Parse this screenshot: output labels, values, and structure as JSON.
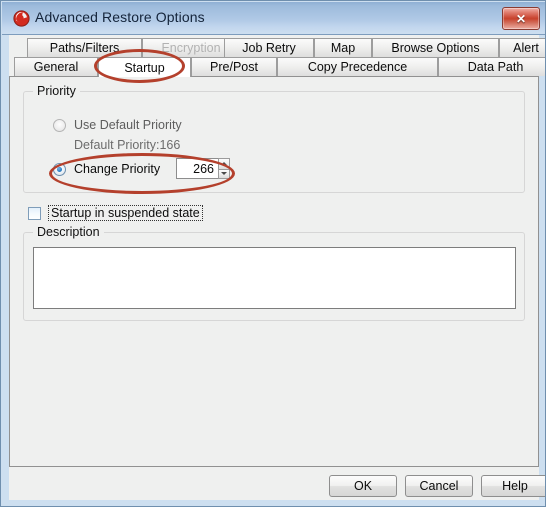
{
  "window": {
    "title": "Advanced Restore Options",
    "icon": "app-logo-icon",
    "close_label": "✕"
  },
  "tabs": {
    "row1": [
      {
        "label": "Paths/Filters",
        "state": "normal"
      },
      {
        "label": "Encryption",
        "state": "disabled"
      },
      {
        "label": "Job Retry",
        "state": "normal"
      },
      {
        "label": "Map",
        "state": "normal"
      },
      {
        "label": "Browse Options",
        "state": "normal"
      },
      {
        "label": "Alert",
        "state": "normal"
      }
    ],
    "row2": [
      {
        "label": "General",
        "state": "normal"
      },
      {
        "label": "Startup",
        "state": "selected"
      },
      {
        "label": "Pre/Post",
        "state": "normal"
      },
      {
        "label": "Copy Precedence",
        "state": "normal"
      },
      {
        "label": "Data Path",
        "state": "normal"
      }
    ]
  },
  "priority": {
    "group_title": "Priority",
    "use_default_label": "Use Default Priority",
    "use_default_selected": false,
    "default_priority_text": "Default Priority:166",
    "change_priority_label": "Change Priority",
    "change_priority_selected": true,
    "priority_value": "266"
  },
  "suspend": {
    "label": "Startup in suspended state",
    "checked": false
  },
  "description": {
    "group_title": "Description",
    "value": "",
    "placeholder": ""
  },
  "buttons": {
    "ok": "OK",
    "cancel": "Cancel",
    "help": "Help"
  },
  "annotations": {
    "accent_color": "#b4402c",
    "highlighted": [
      "Startup tab",
      "Change Priority row"
    ]
  },
  "colors": {
    "titlebar_blue": "#b0c9e6",
    "frame_blue": "#cddff0",
    "panel_gray": "#eff0ef",
    "close_red": "#c8412c",
    "annotation_red": "#b4402c"
  }
}
